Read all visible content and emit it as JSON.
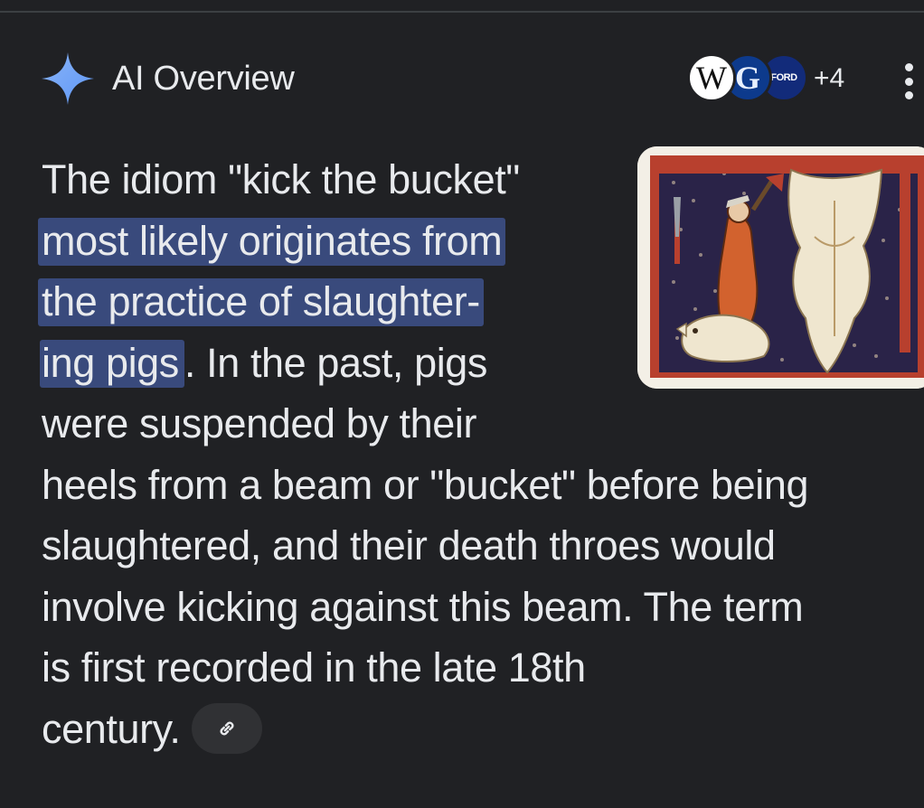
{
  "header": {
    "title": "AI Overview",
    "sources_more": "+4",
    "source_logos": [
      {
        "name": "wikipedia",
        "text": "W"
      },
      {
        "name": "grammarist",
        "text": "G"
      },
      {
        "name": "ford",
        "text": "FORD"
      }
    ]
  },
  "answer": {
    "lines": [
      "The idiom \"kick the bucket\"",
      "most likely originates from",
      "the practice of slaughter-",
      "ing pigs",
      ". In the past, pigs",
      "were suspended by their",
      "heels from a beam or \"bucket\" before being",
      "slaughtered, and their death throes would",
      "involve kicking against this beam. The term",
      "is first recorded in the late 18th",
      "century."
    ]
  },
  "colors": {
    "background": "#202124",
    "text": "#e8eaed",
    "highlight": "#394a7c",
    "chip": "#303134",
    "sparkle": "#7cacf8"
  },
  "icons": [
    "sparkle-icon",
    "more-vert-icon",
    "link-icon"
  ]
}
